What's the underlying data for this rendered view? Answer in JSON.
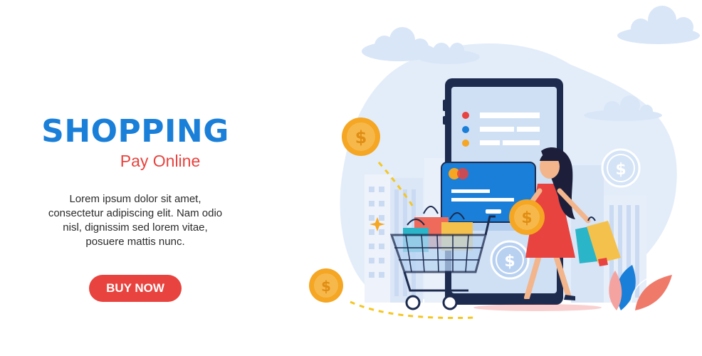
{
  "hero": {
    "title": "SHOPPING",
    "subtitle": "Pay Online",
    "body": "Lorem ipsum dolor sit amet, consectetur adipiscing elit. Nam odio nisl, dignissim sed lorem vitae, posuere mattis nunc.",
    "cta_label": "BUY NOW"
  },
  "illustration": {
    "coin_symbol": "$",
    "icons": [
      "cloud-icon",
      "coin-icon",
      "dollar-icon",
      "smartphone-icon",
      "credit-card-icon",
      "shopping-cart-icon",
      "shopping-bag-icon",
      "sparkle-icon",
      "leaf-icon"
    ]
  },
  "colors": {
    "brand": "#1a7fd8",
    "accent": "#e8433e",
    "coin": "#f5a623",
    "sky": "#dfeaf8",
    "phone_frame": "#1d2b4f"
  }
}
